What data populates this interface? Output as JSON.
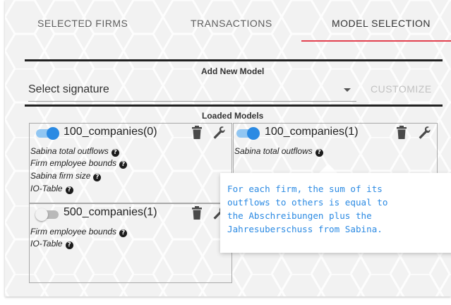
{
  "tabs": [
    {
      "label": "SELECTED FIRMS",
      "active": false
    },
    {
      "label": "TRANSACTIONS",
      "active": false
    },
    {
      "label": "MODEL SELECTION",
      "active": true
    }
  ],
  "colors": {
    "accent": "#e2414f",
    "toggle_on": "#2b8ae3",
    "tooltip_text": "#2b8ae3"
  },
  "add_model": {
    "title": "Add New Model",
    "select_label": "Select signature",
    "customize_label": "CUSTOMIZE"
  },
  "loaded_models": {
    "title": "Loaded Models",
    "models": [
      {
        "name": "100_companies(0)",
        "enabled": true,
        "constraints": [
          "Sabina total outflows",
          "Firm employee bounds",
          "Sabina firm size",
          "IO-Table"
        ]
      },
      {
        "name": "100_companies(1)",
        "enabled": true,
        "constraints": [
          "Sabina total outflows"
        ]
      },
      {
        "name": "500_companies(1)",
        "enabled": false,
        "constraints": [
          "Firm employee bounds",
          "IO-Table"
        ]
      }
    ]
  },
  "tooltip": {
    "text": "For each firm, the sum of its\noutflows to others is equal to\nthe Abschreibungen plus the\nJahresuberschuss from Sabina."
  },
  "icons": {
    "delete": "trash-icon",
    "configure": "wrench-icon",
    "help": "question-circle-icon",
    "dropdown": "caret-down-icon"
  }
}
